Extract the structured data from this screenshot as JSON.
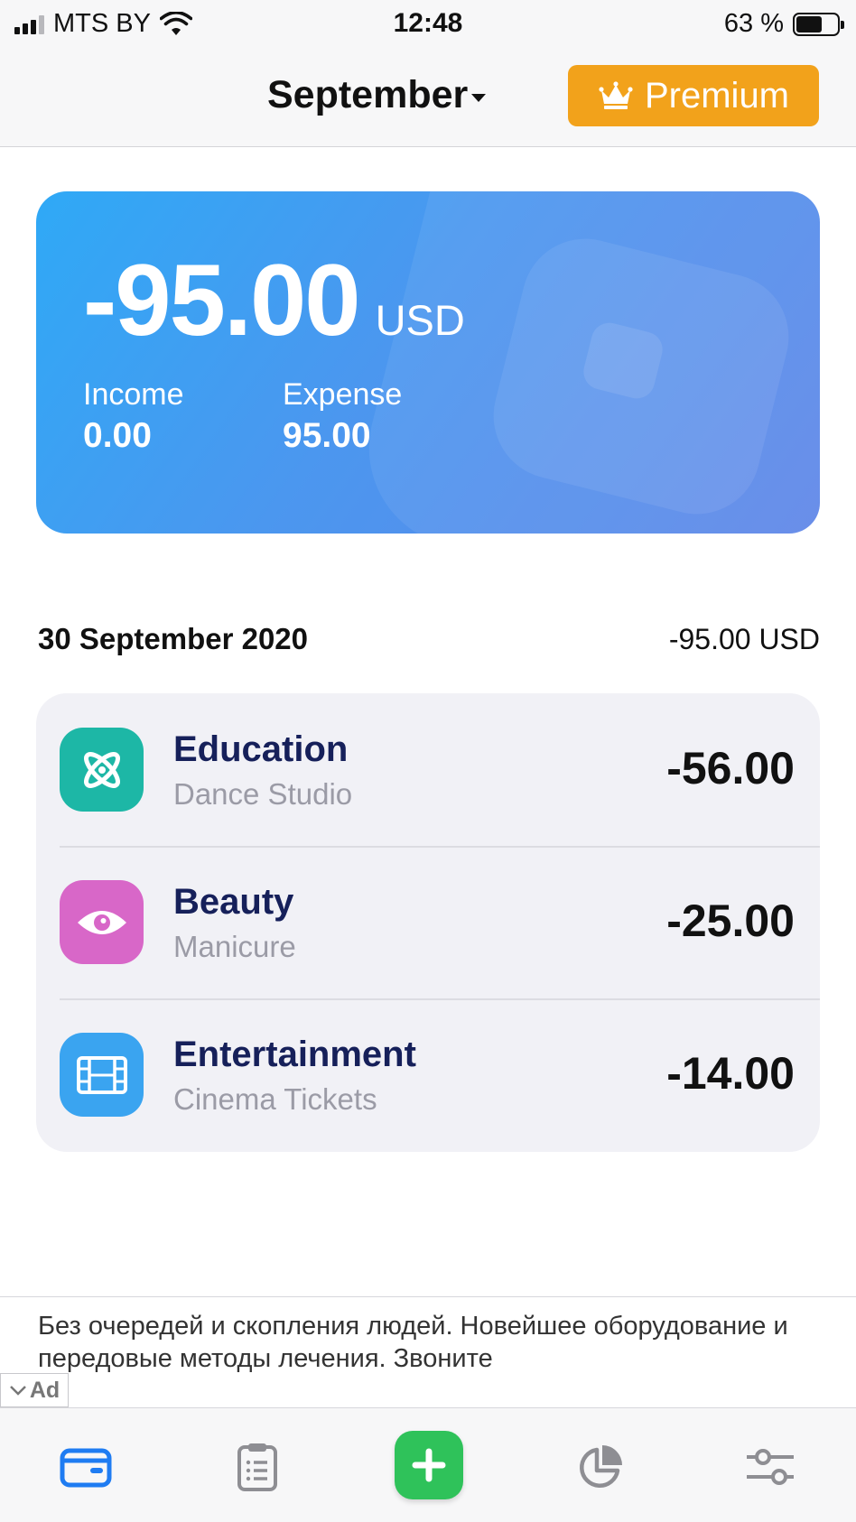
{
  "status_bar": {
    "carrier": "MTS BY",
    "time": "12:48",
    "battery": "63 %",
    "battery_level": 0.63
  },
  "header": {
    "month": "September",
    "premium_label": "Premium"
  },
  "balance": {
    "amount": "-95.00",
    "currency": "USD",
    "income_label": "Income",
    "income_value": "0.00",
    "expense_label": "Expense",
    "expense_value": "95.00"
  },
  "day": {
    "date": "30 September 2020",
    "total": "-95.00 USD"
  },
  "transactions": [
    {
      "category": "Education",
      "note": "Dance Studio",
      "amount": "-56.00",
      "icon": "atom-icon",
      "color": "#1db7a6"
    },
    {
      "category": "Beauty",
      "note": "Manicure",
      "amount": "-25.00",
      "icon": "eye-icon",
      "color": "#d867c8"
    },
    {
      "category": "Entertainment",
      "note": "Cinema Tickets",
      "amount": "-14.00",
      "icon": "film-icon",
      "color": "#3aa4f0"
    }
  ],
  "ad": {
    "text": "Без очередей и скопления людей. Новейшее оборудование и передовые методы лечения. Звоните",
    "badge": "Ad"
  },
  "tab_bar": {
    "active_color": "#1f7cf2",
    "inactive_color": "#8e8e93",
    "add_color": "#2fc25a",
    "tabs": [
      "wallet-icon",
      "clipboard-icon",
      "plus-icon",
      "pie-chart-icon",
      "sliders-icon"
    ]
  }
}
